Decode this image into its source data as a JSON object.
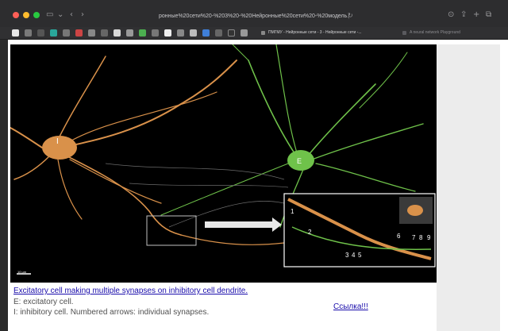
{
  "browser": {
    "url": "ронные%20сети%20-%203%20-%20Нейронные%20сети%20-%20модель.pdf",
    "tabs": [
      {
        "label": "ПМГМУ - Нейронные сети - 3 - Нейронные сети -..."
      },
      {
        "label": "A neural network Playground"
      }
    ],
    "colors": {
      "titlebar": "#2d2d2f",
      "bookmarks": "#303032"
    }
  },
  "figure": {
    "label_inhibitory": "I",
    "label_excitatory": "E",
    "scale_bar": "10 µm",
    "inset_labels": [
      "1",
      "2",
      "3",
      "4",
      "5",
      "6",
      "7",
      "8",
      "9"
    ],
    "colors": {
      "inhibitory": "#d9914a",
      "excitatory": "#6fc24a",
      "background": "#000000"
    }
  },
  "caption": {
    "line1": "Excitatory cell making multiple synapses on inhibitory cell dendrite.",
    "line2": "E: excitatory cell.",
    "line3": "I: inhibitory cell. Numbered arrows: individual synapses."
  },
  "link": {
    "label": "Ссылка!!!"
  }
}
